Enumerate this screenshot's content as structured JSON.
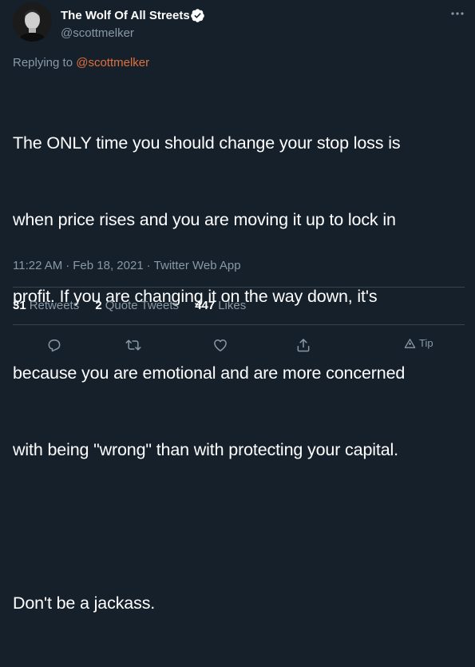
{
  "author": {
    "display_name": "The Wolf Of All Streets",
    "handle": "@scottmelker",
    "verified": true,
    "avatar_icon": "avatar-photo"
  },
  "reply_context": {
    "prefix": "Replying to ",
    "mention": "@scottmelker"
  },
  "tweet": {
    "lines": [
      "The ONLY time you should change your stop loss is",
      "when price rises and you are moving it up to lock in",
      "profit. If you are changing it on the way down, it's",
      "because you are emotional and are more concerned",
      "with being \"wrong\" than with protecting your capital."
    ],
    "closing_line": "Don't be a jackass."
  },
  "meta": {
    "time": "11:22 AM",
    "separator": "·",
    "date": "Feb 18, 2021",
    "source": "Twitter Web App"
  },
  "stats": {
    "retweets_count": "31",
    "retweets_label": "Retweets",
    "quotes_count": "2",
    "quotes_label": "Quote Tweets",
    "likes_count": "447",
    "likes_label": "Likes"
  },
  "actions": {
    "tip_label": "Tip"
  },
  "colors": {
    "background": "#15202b",
    "secondary_text": "#8899a6",
    "mention": "#e0703d",
    "verified": "#ffffff",
    "divider": "#38444d"
  }
}
